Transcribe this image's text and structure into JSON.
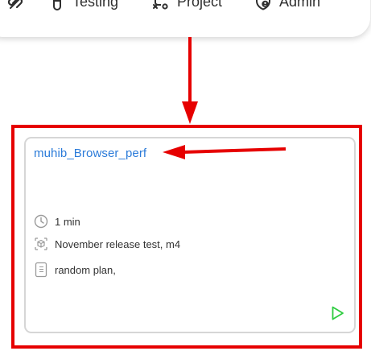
{
  "navbar": {
    "logo_icon": "link-logo-icon",
    "items": [
      {
        "label": "Testing",
        "icon": "flask-icon"
      },
      {
        "label": "Project",
        "icon": "workflow-icon"
      },
      {
        "label": "Admin",
        "icon": "shield-user-icon"
      }
    ]
  },
  "annotations": {
    "color": "#e60000"
  },
  "card": {
    "title": "muhib_Browser_perf",
    "duration": "1 min",
    "release": "November release test, m4",
    "plan": "random plan,",
    "run_icon": "play-icon",
    "title_color": "#2b7bd9",
    "run_color": "#2ecc40"
  }
}
